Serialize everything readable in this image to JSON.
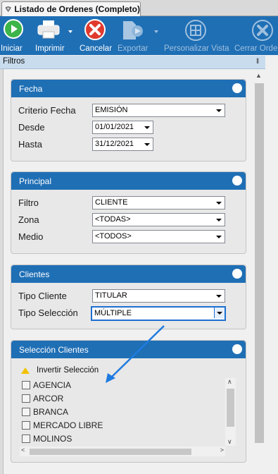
{
  "window": {
    "tab_title": "Listado de Ordenes (Completo)"
  },
  "toolbar": {
    "iniciar": "Iniciar",
    "imprimir": "Imprimir",
    "cancelar": "Cancelar",
    "exportar": "Exportar",
    "personalizar": "Personalizar Vista",
    "cerrar": "Cerrar Orde"
  },
  "filtros": {
    "title": "Filtros"
  },
  "fecha": {
    "title": "Fecha",
    "criterio_label": "Criterio Fecha",
    "criterio_value": "EMISIÓN",
    "desde_label": "Desde",
    "desde_value": "01/01/2021",
    "hasta_label": "Hasta",
    "hasta_value": "31/12/2021"
  },
  "principal": {
    "title": "Principal",
    "filtro_label": "Filtro",
    "filtro_value": "CLIENTE",
    "zona_label": "Zona",
    "zona_value": "<TODAS>",
    "medio_label": "Medio",
    "medio_value": "<TODOS>"
  },
  "clientes": {
    "title": "Clientes",
    "tipo_cliente_label": "Tipo Cliente",
    "tipo_cliente_value": "TITULAR",
    "tipo_seleccion_label": "Tipo Selección",
    "tipo_seleccion_value": "MÚLTIPLE"
  },
  "seleccion": {
    "title": "Selección Clientes",
    "invertir_label": "Invertir Selección",
    "items": [
      "AGENCIA",
      "ARCOR",
      "BRANCA",
      "MERCADO LIBRE",
      "MOLINOS"
    ]
  },
  "colors": {
    "accent": "#1f6fb5",
    "focus": "#1d6fd1",
    "annotation_arrow": "#1e7be0"
  }
}
